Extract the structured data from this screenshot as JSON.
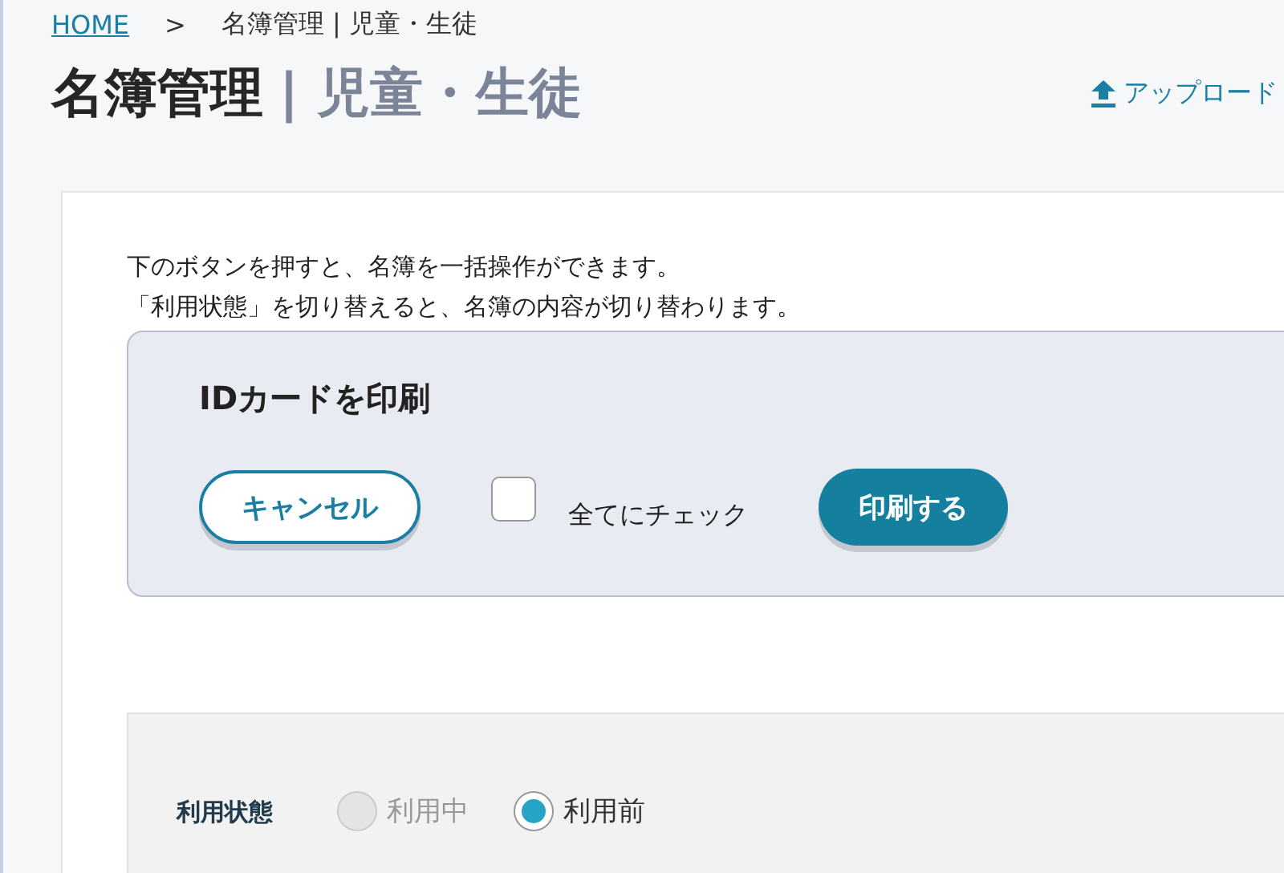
{
  "breadcrumb": [
    {
      "label": "HOME",
      "link": true
    },
    {
      "label": ">",
      "link": false
    },
    {
      "label": "名簿管理 | 児童・生徒",
      "link": false
    }
  ],
  "title": {
    "main": "名簿管理",
    "sub": "| 児童・生徒"
  },
  "upload_link": "アップロード",
  "description": [
    "下のボタンを押すと、名簿を一括操作ができます。",
    "「利用状態」を切り替えると、名簿の内容が切り替わります。"
  ],
  "print_panel": {
    "heading": "IDカードを印刷",
    "cancel_button": "キャンセル",
    "check_all": {
      "label": "全てにチェック",
      "checked": false
    },
    "print_button": "印刷する"
  },
  "filter": {
    "label": "利用状態",
    "options": [
      {
        "label": "利用中",
        "selected": false,
        "disabled": true
      },
      {
        "label": "利用前",
        "selected": true,
        "disabled": false
      }
    ]
  }
}
